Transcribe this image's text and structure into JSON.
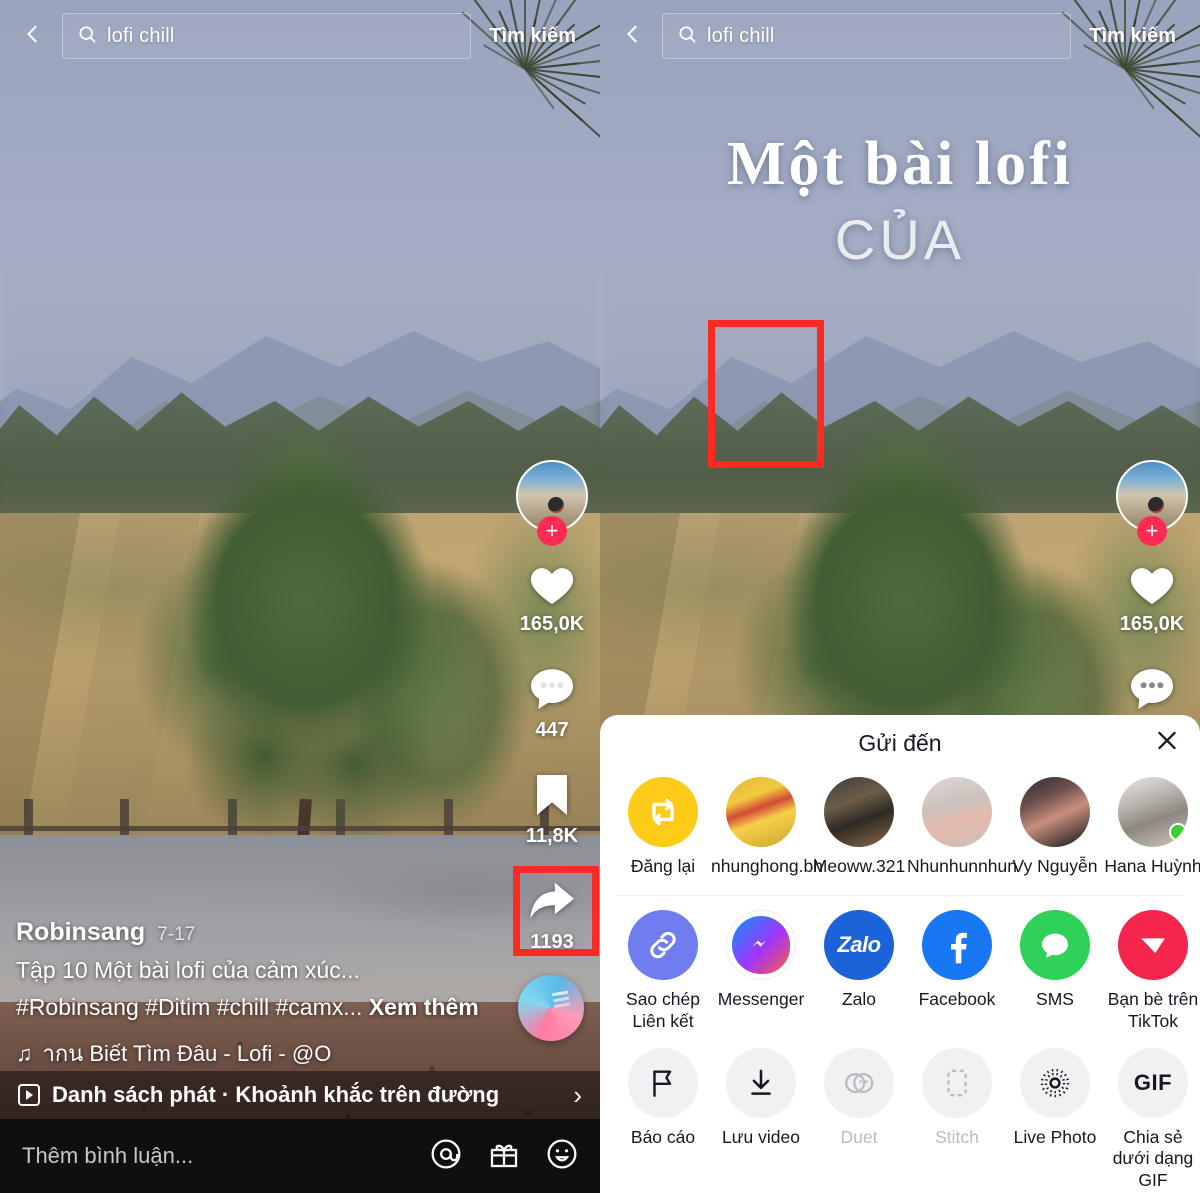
{
  "search": {
    "back_icon": "chevron-left-icon",
    "search_icon": "search-icon",
    "value": "lofi chill",
    "placeholder": "Tìm kiếm",
    "submit_label": "Tìm kiếm"
  },
  "video_overlay_text": {
    "line1": "Một bài lofi",
    "line2": "CỦA"
  },
  "rail": {
    "follow_plus": "+",
    "like_count": "165,0K",
    "comment_count": "447",
    "bookmark_count": "11,8K",
    "share_count": "1193",
    "icons": {
      "avatar": "avatar",
      "like": "heart-icon",
      "comment": "comment-icon",
      "bookmark": "bookmark-icon",
      "share": "share-arrow-icon",
      "music_disc": "music-disc-icon"
    }
  },
  "caption": {
    "username": "Robinsang",
    "timestamp": "7-17",
    "line1": "Tập 10  Một bài lofi của cảm xúc...",
    "line2": "#Robinsang #Ditim #chill #camx...",
    "see_more": "Xem thêm",
    "music_note_icon": "music-note-icon",
    "music": "ากน   Biết Tìm Đâu - Lofi - @O"
  },
  "playlist": {
    "icon": "playlist-icon",
    "text": "Danh sách phát · Khoảnh khắc trên đường",
    "chevron": "chevron-right-icon"
  },
  "comment_bar": {
    "placeholder": "Thêm bình luận...",
    "icons": [
      "mention-icon",
      "gift-icon",
      "emoji-icon"
    ]
  },
  "share_sheet": {
    "title": "Gửi đến",
    "close_icon": "close-icon",
    "contacts": [
      {
        "label": "Đăng lại",
        "icon": "repost-icon",
        "avatar_class": "repost",
        "online": false
      },
      {
        "label": "nhunghong.bh",
        "icon": "avatar",
        "avatar_class": "av-nhung",
        "online": false
      },
      {
        "label": "Meoww.321",
        "icon": "avatar",
        "avatar_class": "av-meow",
        "online": false
      },
      {
        "label": "Nhunhunnhun",
        "icon": "avatar",
        "avatar_class": "av-nhun",
        "online": false
      },
      {
        "label": "Vy Nguyễn",
        "icon": "avatar",
        "avatar_class": "av-vy",
        "online": false
      },
      {
        "label": "Hana Huỳnh",
        "icon": "avatar",
        "avatar_class": "av-hana",
        "online": true
      }
    ],
    "apps": [
      {
        "label": "Sao chép Liên kết",
        "icon": "link-icon"
      },
      {
        "label": "Messenger",
        "icon": "messenger-icon"
      },
      {
        "label": "Zalo",
        "icon": "zalo-icon"
      },
      {
        "label": "Facebook",
        "icon": "facebook-icon"
      },
      {
        "label": "SMS",
        "icon": "sms-icon"
      },
      {
        "label": "Bạn bè trên TikTok",
        "icon": "tiktok-friends-icon"
      }
    ],
    "actions": [
      {
        "label": "Báo cáo",
        "icon": "flag-icon",
        "disabled": false
      },
      {
        "label": "Lưu video",
        "icon": "download-icon",
        "disabled": false
      },
      {
        "label": "Duet",
        "icon": "duet-icon",
        "disabled": true
      },
      {
        "label": "Stitch",
        "icon": "stitch-icon",
        "disabled": true
      },
      {
        "label": "Live Photo",
        "icon": "live-photo-icon",
        "disabled": false
      },
      {
        "label": "Chia sẻ dưới dạng GIF",
        "icon": "gif-icon",
        "disabled": false
      }
    ]
  },
  "highlights": {
    "share_button_color": "#fb2a22",
    "save_video_color": "#fb2a22"
  },
  "colors": {
    "tiktok_pink": "#fe2c55",
    "repost_yellow": "#fdcb18",
    "messenger_blue": "#0695ff",
    "zalo_blue": "#1b63d8",
    "facebook_blue": "#1877f2",
    "sms_green": "#30d158",
    "tiktok_friend_red": "#f5254d",
    "online_green": "#3ccf2f"
  }
}
